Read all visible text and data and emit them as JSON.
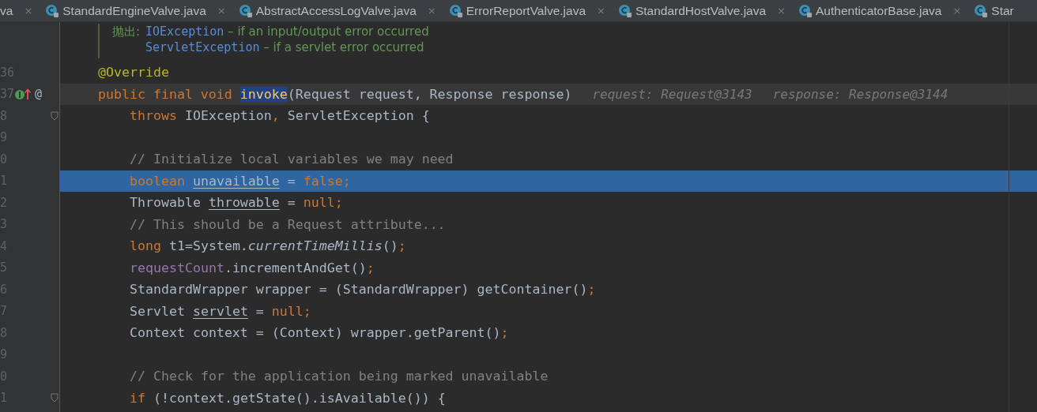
{
  "tabs": [
    {
      "label": "va",
      "close": "×"
    },
    {
      "label": "StandardEngineValve.java",
      "close": "×"
    },
    {
      "label": "AbstractAccessLogValve.java",
      "close": "×"
    },
    {
      "label": "ErrorReportValve.java",
      "close": "×"
    },
    {
      "label": "StandardHostValve.java",
      "close": "×"
    },
    {
      "label": "AuthenticatorBase.java",
      "close": "×"
    },
    {
      "label": "Star"
    }
  ],
  "doc": [
    {
      "label": "抛出:",
      "tokens": [
        {
          "t": "IOException",
          "kind": "link"
        },
        {
          "t": " – if an input/output error occurred",
          "kind": "text"
        }
      ]
    },
    {
      "tokens": [
        {
          "t": "ServletException",
          "kind": "link"
        },
        {
          "t": " – if a servlet error occurred",
          "kind": "text"
        }
      ]
    }
  ],
  "lines": [
    {
      "number": "36",
      "current": false,
      "highlighted": false,
      "tokens": [
        {
          "t": "@Override",
          "kind": "annotation"
        }
      ]
    },
    {
      "number": "37",
      "current": true,
      "highlighted": false,
      "override_icon": true,
      "at_marker": "@",
      "tokens": [
        {
          "t": "public final void ",
          "kind": "keyword"
        },
        {
          "t": "invoke",
          "kind": "selected"
        },
        {
          "t": "(Request request, Response response)",
          "kind": "plain"
        }
      ],
      "hints": [
        "request: Request@3143",
        "response: Response@3144"
      ],
      "children": [
        {
          "number": "8",
          "current": false,
          "highlighted": false,
          "fold": true,
          "tokens": [
            {
              "t": "throws ",
              "kind": "keyword"
            },
            {
              "t": "IOException",
              "kind": "plain"
            },
            {
              "t": ", ",
              "kind": "keyword"
            },
            {
              "t": "ServletException {",
              "kind": "plain"
            }
          ]
        },
        {
          "number": "9",
          "current": false,
          "highlighted": false
        },
        {
          "number": "0",
          "current": false,
          "highlighted": false,
          "tokens": [
            {
              "t": "// Initialize local variables we may need",
              "kind": "comment"
            }
          ]
        },
        {
          "number": "1",
          "current": false,
          "highlighted": true,
          "tokens": [
            {
              "t": "boolean ",
              "kind": "keyword"
            },
            {
              "t": "unavailable",
              "kind": "underline"
            },
            {
              "t": " = ",
              "kind": "plain"
            },
            {
              "t": "false;",
              "kind": "keyword"
            }
          ]
        },
        {
          "number": "2",
          "current": false,
          "highlighted": false,
          "tokens": [
            {
              "t": "Throwable ",
              "kind": "plain"
            },
            {
              "t": "throwable",
              "kind": "underline"
            },
            {
              "t": " = ",
              "kind": "plain"
            },
            {
              "t": "null;",
              "kind": "keyword"
            }
          ]
        },
        {
          "number": "3",
          "current": false,
          "highlighted": false,
          "tokens": [
            {
              "t": "// This should be a Request attribute...",
              "kind": "comment"
            }
          ]
        },
        {
          "number": "4",
          "current": false,
          "highlighted": false,
          "tokens": [
            {
              "t": "long ",
              "kind": "keyword"
            },
            {
              "t": "t1=System.",
              "kind": "plain"
            },
            {
              "t": "currentTimeMillis",
              "kind": "italic"
            },
            {
              "t": "()",
              "kind": "plain"
            },
            {
              "t": ";",
              "kind": "keyword"
            }
          ]
        },
        {
          "number": "5",
          "current": false,
          "highlighted": false,
          "tokens": [
            {
              "t": "requestCount",
              "kind": "field"
            },
            {
              "t": ".incrementAndGet()",
              "kind": "plain"
            },
            {
              "t": ";",
              "kind": "keyword"
            }
          ]
        },
        {
          "number": "6",
          "current": false,
          "highlighted": false,
          "tokens": [
            {
              "t": "StandardWrapper wrapper = (StandardWrapper) getContainer()",
              "kind": "plain"
            },
            {
              "t": ";",
              "kind": "keyword"
            }
          ]
        },
        {
          "number": "7",
          "current": false,
          "highlighted": false,
          "tokens": [
            {
              "t": "Servlet ",
              "kind": "plain"
            },
            {
              "t": "servlet",
              "kind": "underline"
            },
            {
              "t": " = ",
              "kind": "plain"
            },
            {
              "t": "null;",
              "kind": "keyword"
            }
          ]
        },
        {
          "number": "8",
          "current": false,
          "highlighted": false,
          "tokens": [
            {
              "t": "Context context = (Context) wrapper.getParent()",
              "kind": "plain"
            },
            {
              "t": ";",
              "kind": "keyword"
            }
          ]
        },
        {
          "number": "9",
          "current": false,
          "highlighted": false
        },
        {
          "number": "0",
          "current": false,
          "highlighted": false,
          "tokens": [
            {
              "t": "// Check for the application being marked unavailable",
              "kind": "comment"
            }
          ]
        },
        {
          "number": "1",
          "current": false,
          "highlighted": false,
          "fold": true,
          "tokens": [
            {
              "t": "if ",
              "kind": "keyword"
            },
            {
              "t": "(!context.getState().isAvailable()) {",
              "kind": "plain"
            }
          ]
        }
      ]
    }
  ]
}
